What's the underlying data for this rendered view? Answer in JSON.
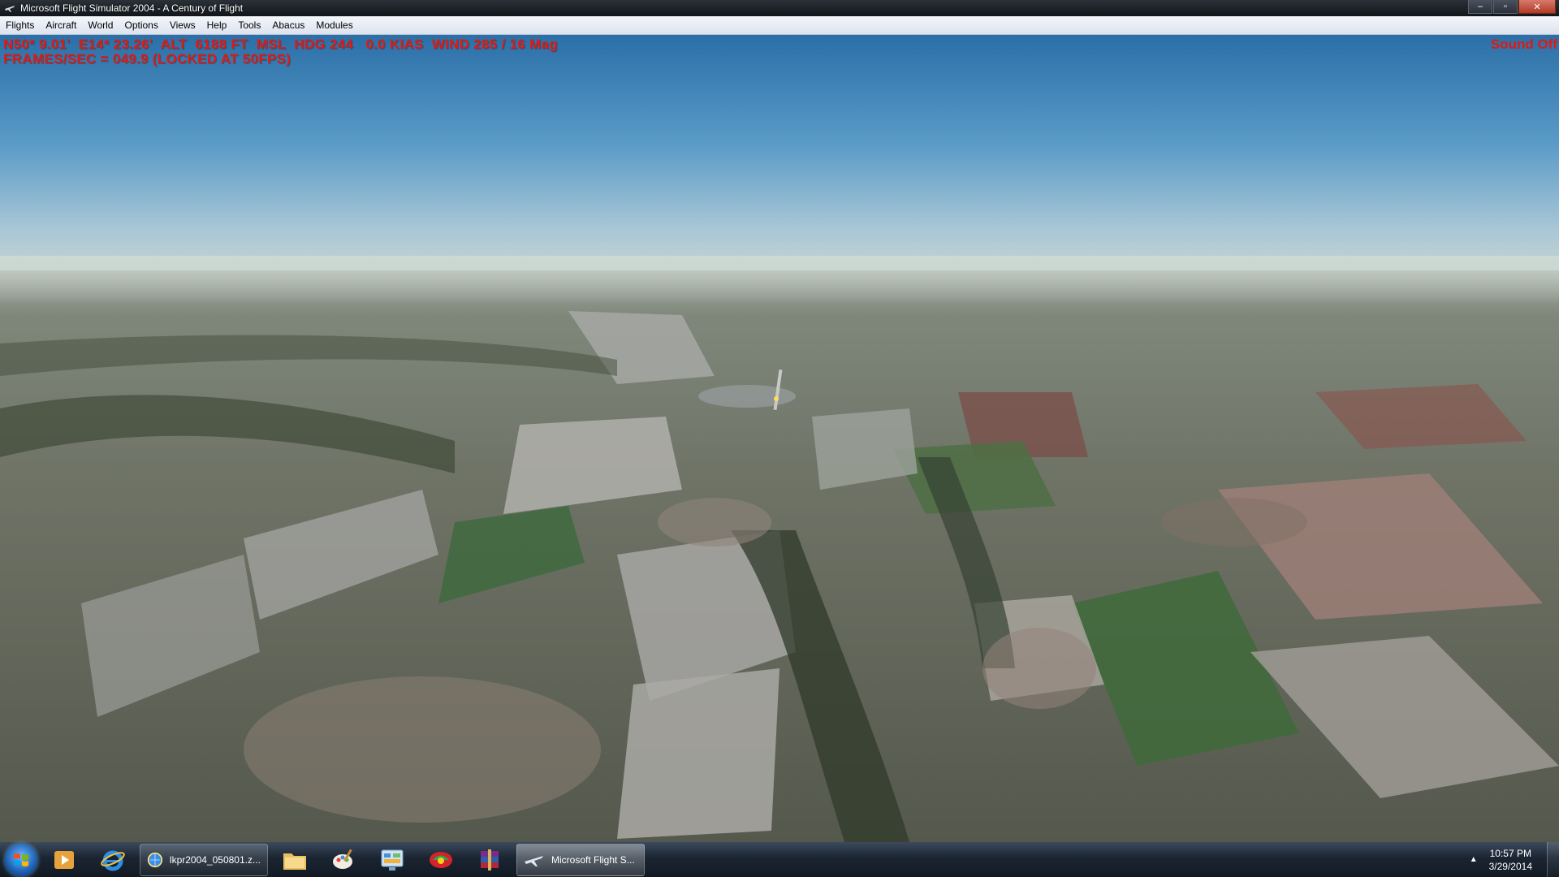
{
  "window": {
    "title": "Microsoft Flight Simulator 2004 - A Century of Flight",
    "minimize_glyph": "–",
    "maximize_glyph": "▫",
    "close_glyph": "✕"
  },
  "menu": {
    "items": [
      "Flights",
      "Aircraft",
      "World",
      "Options",
      "Views",
      "Help",
      "Tools",
      "Abacus",
      "Modules"
    ]
  },
  "hud": {
    "line1": "N50* 9.01'  E14* 23.26'  ALT  6188 FT  MSL  HDG 244   0.0 KIAS  WIND 285 / 16 Mag",
    "line2": "FRAMES/SEC = 049.9 (LOCKED AT 50FPS)",
    "sound_status": "Sound Off",
    "color": "#e01a12"
  },
  "taskbar": {
    "tasks": [
      {
        "label": "lkpr2004_050801.z...",
        "icon": "winamp-globe-icon"
      },
      {
        "label": "Microsoft Flight S...",
        "icon": "airplane-icon"
      }
    ],
    "pinned_icons": [
      "media-player-icon",
      "internet-explorer-icon",
      "folder-icon",
      "paint-icon",
      "control-panel-icon",
      "hotspot-icon",
      "winrar-icon"
    ],
    "tray_arrow": "▲",
    "clock": {
      "time": "10:57 PM",
      "date": "3/29/2014"
    }
  }
}
